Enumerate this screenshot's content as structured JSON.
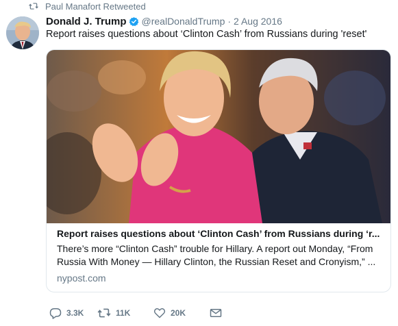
{
  "retweet_context": {
    "icon": "retweet-icon",
    "text": "Paul Manafort Retweeted"
  },
  "author": {
    "display_name": "Donald J. Trump",
    "verified_icon": "verified-badge-icon",
    "handle": "@realDonaldTrump",
    "separator": "·",
    "date": "2 Aug 2016"
  },
  "tweet": {
    "text": "Report raises questions about ‘Clinton Cash’ from Russians during 'reset'"
  },
  "card": {
    "title": "Report raises questions about ‘Clinton Cash’ from Russians during ‘r...",
    "description_line1": "There’s more “Clinton Cash” trouble for Hillary. A report out Monday, “From",
    "description_line2": "Russia With Money — Hillary Clinton, the Russian Reset and Cronyism,” ...",
    "domain": "nypost.com"
  },
  "actions": {
    "reply": {
      "icon": "reply-icon",
      "count": "3.3K"
    },
    "retweet": {
      "icon": "retweet-icon",
      "count": "11K"
    },
    "like": {
      "icon": "heart-icon",
      "count": "20K"
    },
    "dm": {
      "icon": "envelope-icon"
    }
  },
  "colors": {
    "secondary_text": "#657786",
    "verified_blue": "#1da1f2",
    "card_border": "#e1e8ed"
  }
}
